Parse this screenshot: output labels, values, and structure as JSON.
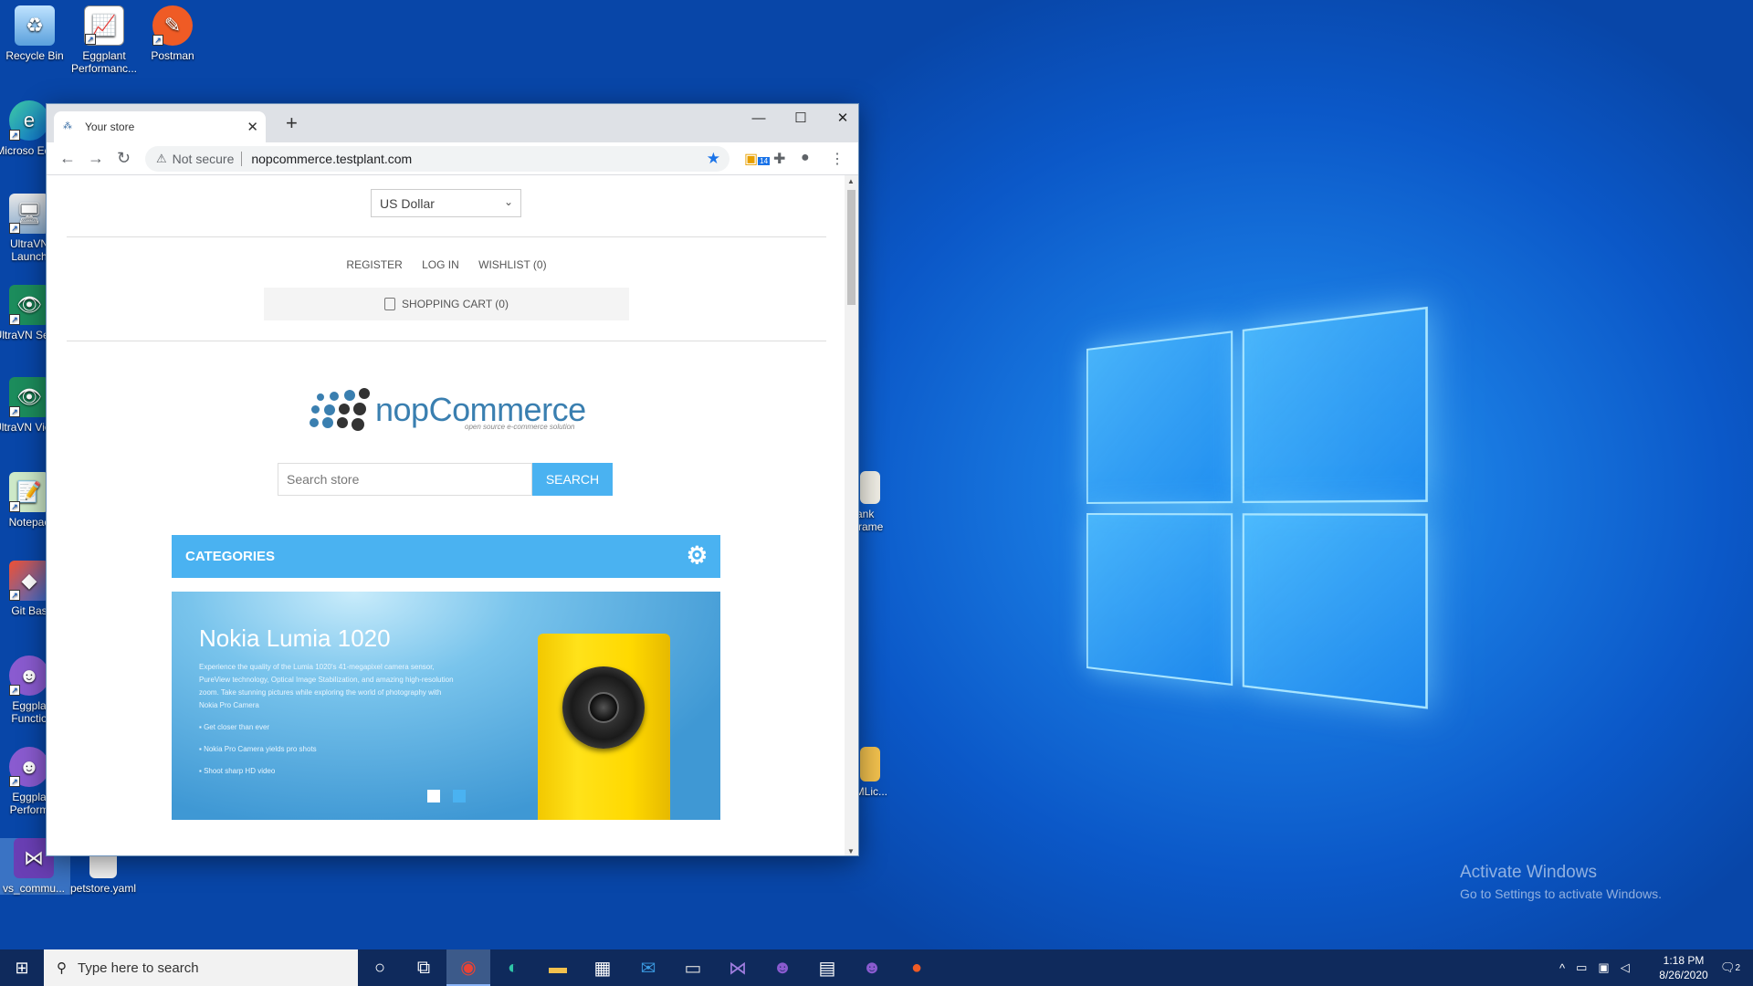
{
  "desktop": {
    "icons": [
      {
        "label": "Recycle Bin",
        "icon": "recycle-bin-icon"
      },
      {
        "label": "Eggplant Performanc...",
        "icon": "eggplant-performance-icon"
      },
      {
        "label": "Postman",
        "icon": "postman-icon"
      },
      {
        "label": "Microso Edge",
        "icon": "edge-icon"
      },
      {
        "label": "UltraVN Launch",
        "icon": "ultravnc-launcher-icon"
      },
      {
        "label": "UltraVN Serve",
        "icon": "ultravnc-server-icon"
      },
      {
        "label": "UltraVN Viewe",
        "icon": "ultravnc-viewer-icon"
      },
      {
        "label": "Notepac",
        "icon": "notepad-icon"
      },
      {
        "label": "Git Bas",
        "icon": "git-bash-icon"
      },
      {
        "label": "Eggpla Functio",
        "icon": "eggplant-functional-icon"
      },
      {
        "label": "Eggpla Perform",
        "icon": "eggplant-performance-icon"
      },
      {
        "label": "vs_commu...",
        "icon": "visual-studio-installer-icon"
      },
      {
        "label": "petstore.yaml",
        "icon": "file-icon"
      },
      {
        "label": "Bank nframe",
        "icon": "file-icon"
      },
      {
        "label": "LMLic...",
        "icon": "zip-folder-icon"
      }
    ],
    "activate_title": "Activate Windows",
    "activate_sub": "Go to Settings to activate Windows."
  },
  "browser": {
    "tab_title": "Your store",
    "not_secure": "Not secure",
    "url": "nopcommerce.testplant.com",
    "extension_badge": "14"
  },
  "page": {
    "currency": "US Dollar",
    "links": [
      "REGISTER",
      "LOG IN",
      "WISHLIST (0)"
    ],
    "cart": "SHOPPING CART (0)",
    "logo_text": "nopCommerce",
    "logo_tagline": "open source e-commerce solution",
    "search_placeholder": "Search store",
    "search_button": "SEARCH",
    "categories": "CATEGORIES",
    "slider": {
      "title": "Nokia Lumia 1020",
      "description": "Experience the quality of the Lumia 1020's 41-megapixel camera sensor, PureView technology, Optical Image Stabilization, and amazing high-resolution zoom. Take stunning pictures while exploring the world of photography with Nokia Pro Camera",
      "bullets": [
        "Get closer than ever",
        "Nokia Pro Camera yields pro shots",
        "Shoot sharp HD video"
      ]
    }
  },
  "taskbar": {
    "search_placeholder": "Type here to search",
    "time": "1:18 PM",
    "date": "8/26/2020",
    "notifications": "2"
  },
  "colors": {
    "accent": "#4ab2f1",
    "taskbar": "#0f2a5c"
  }
}
